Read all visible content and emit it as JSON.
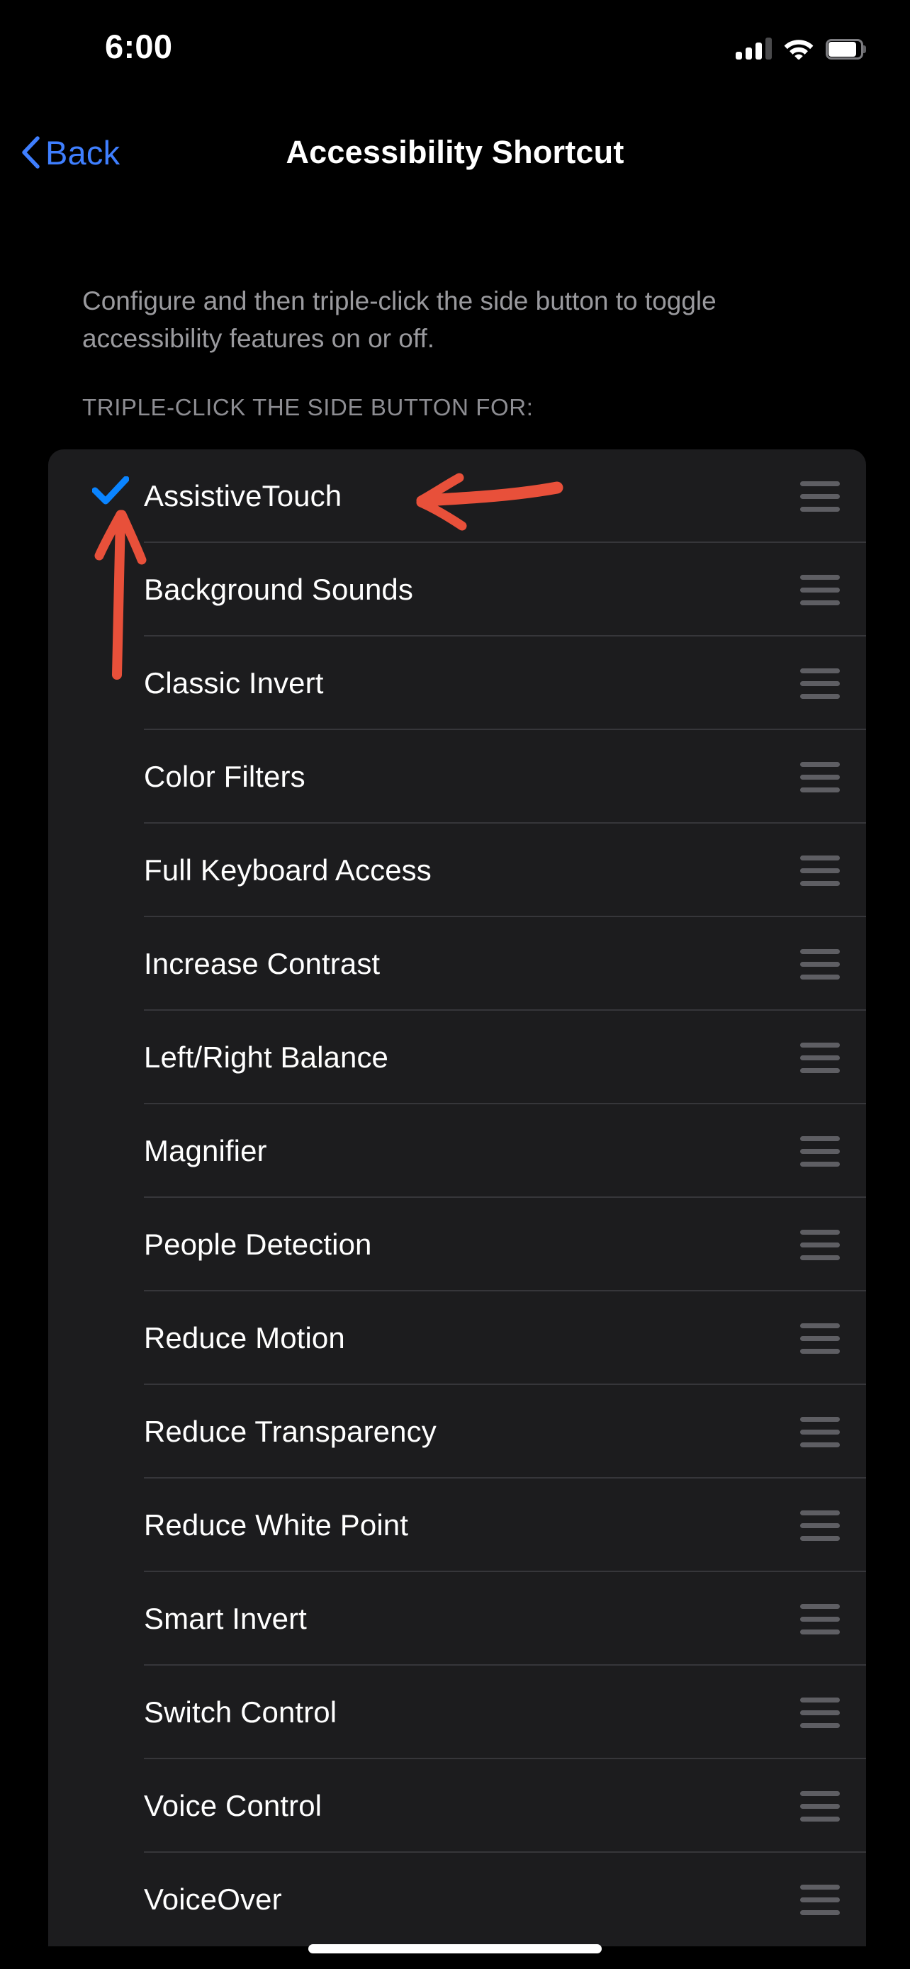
{
  "status_bar": {
    "time": "6:00",
    "signal_icon": "cellular-signal-icon",
    "wifi_icon": "wifi-icon",
    "battery_icon": "battery-icon",
    "battery_level_percent": 85
  },
  "nav_bar": {
    "back_label": "Back",
    "back_icon": "chevron-left-icon",
    "title": "Accessibility Shortcut",
    "accent_color": "#3f7fff"
  },
  "description": "Configure and then triple-click the side button to toggle accessibility features on or off.",
  "section_header": "TRIPLE-CLICK THE SIDE BUTTON FOR:",
  "list": {
    "checkmark_color": "#0a84ff",
    "rows": [
      {
        "label": "AssistiveTouch",
        "checked": true,
        "handle_icon": "reorder-handle-icon"
      },
      {
        "label": "Background Sounds",
        "checked": false,
        "handle_icon": "reorder-handle-icon"
      },
      {
        "label": "Classic Invert",
        "checked": false,
        "handle_icon": "reorder-handle-icon"
      },
      {
        "label": "Color Filters",
        "checked": false,
        "handle_icon": "reorder-handle-icon"
      },
      {
        "label": "Full Keyboard Access",
        "checked": false,
        "handle_icon": "reorder-handle-icon"
      },
      {
        "label": "Increase Contrast",
        "checked": false,
        "handle_icon": "reorder-handle-icon"
      },
      {
        "label": "Left/Right Balance",
        "checked": false,
        "handle_icon": "reorder-handle-icon"
      },
      {
        "label": "Magnifier",
        "checked": false,
        "handle_icon": "reorder-handle-icon"
      },
      {
        "label": "People Detection",
        "checked": false,
        "handle_icon": "reorder-handle-icon"
      },
      {
        "label": "Reduce Motion",
        "checked": false,
        "handle_icon": "reorder-handle-icon"
      },
      {
        "label": "Reduce Transparency",
        "checked": false,
        "handle_icon": "reorder-handle-icon"
      },
      {
        "label": "Reduce White Point",
        "checked": false,
        "handle_icon": "reorder-handle-icon"
      },
      {
        "label": "Smart Invert",
        "checked": false,
        "handle_icon": "reorder-handle-icon"
      },
      {
        "label": "Switch Control",
        "checked": false,
        "handle_icon": "reorder-handle-icon"
      },
      {
        "label": "Voice Control",
        "checked": false,
        "handle_icon": "reorder-handle-icon"
      },
      {
        "label": "VoiceOver",
        "checked": false,
        "handle_icon": "reorder-handle-icon"
      }
    ]
  },
  "annotations": {
    "color": "#e8503a",
    "items": [
      {
        "name": "arrow-pointing-to-assistivetouch-label",
        "direction": "left"
      },
      {
        "name": "arrow-pointing-to-checkmark",
        "direction": "up"
      }
    ]
  },
  "home_indicator": "home-indicator"
}
